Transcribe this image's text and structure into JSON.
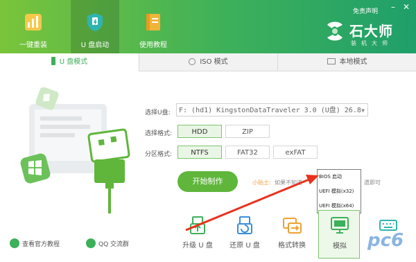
{
  "header": {
    "top_links": {
      "disclaimer": "免责声明"
    },
    "nav": [
      {
        "label": "一键重装",
        "icon": "chart-icon",
        "active": false
      },
      {
        "label": "U 盘启动",
        "icon": "usb-shield-icon",
        "active": true
      },
      {
        "label": "使用教程",
        "icon": "book-icon",
        "active": false
      }
    ],
    "logo": {
      "name": "石大师",
      "sub": "装机大师"
    }
  },
  "tabs": [
    {
      "label": "U 盘模式",
      "icon": "usb-icon",
      "active": true
    },
    {
      "label": "ISO 模式",
      "icon": "disc-icon",
      "active": false
    },
    {
      "label": "本地模式",
      "icon": "monitor-icon",
      "active": false
    }
  ],
  "form": {
    "usb_label": "选择U盘:",
    "usb_value": "F: (hd1) KingstonDataTraveler 3.0 (U盘) 26.8",
    "format_label": "选择格式:",
    "formats": [
      "HDD",
      "ZIP"
    ],
    "selected_format": "HDD",
    "partition_label": "分区格式:",
    "partitions": [
      "NTFS",
      "FAT32",
      "exFAT"
    ],
    "selected_partition": "NTFS",
    "start_button": "开始制作",
    "tip_prefix": "小贴士:",
    "tip_text": "如果不知道",
    "tip_suffix": "遗即可"
  },
  "dropdown": {
    "items": [
      "BIOS 启动",
      "UEFI 模拟(x32)",
      "UEFI 模拟(x64)"
    ]
  },
  "tools": [
    {
      "label": "升级 U 盘",
      "icon": "usb-upgrade-icon"
    },
    {
      "label": "还原 U 盘",
      "icon": "usb-restore-icon"
    },
    {
      "label": "格式转换",
      "icon": "format-convert-icon"
    },
    {
      "label": "模拟",
      "icon": "simulate-monitor-icon"
    },
    {
      "label": "",
      "icon": "keyboard-icon"
    }
  ],
  "bottom_links": [
    {
      "label": "查看官方教程",
      "icon": "book-icon"
    },
    {
      "label": "QQ 交流群",
      "icon": "qq-group-icon"
    }
  ],
  "watermark": "pc6",
  "colors": {
    "brand": "#3db05a",
    "accent": "#5fb63b",
    "tip": "#f39c3c",
    "arrow": "#e8321e"
  }
}
